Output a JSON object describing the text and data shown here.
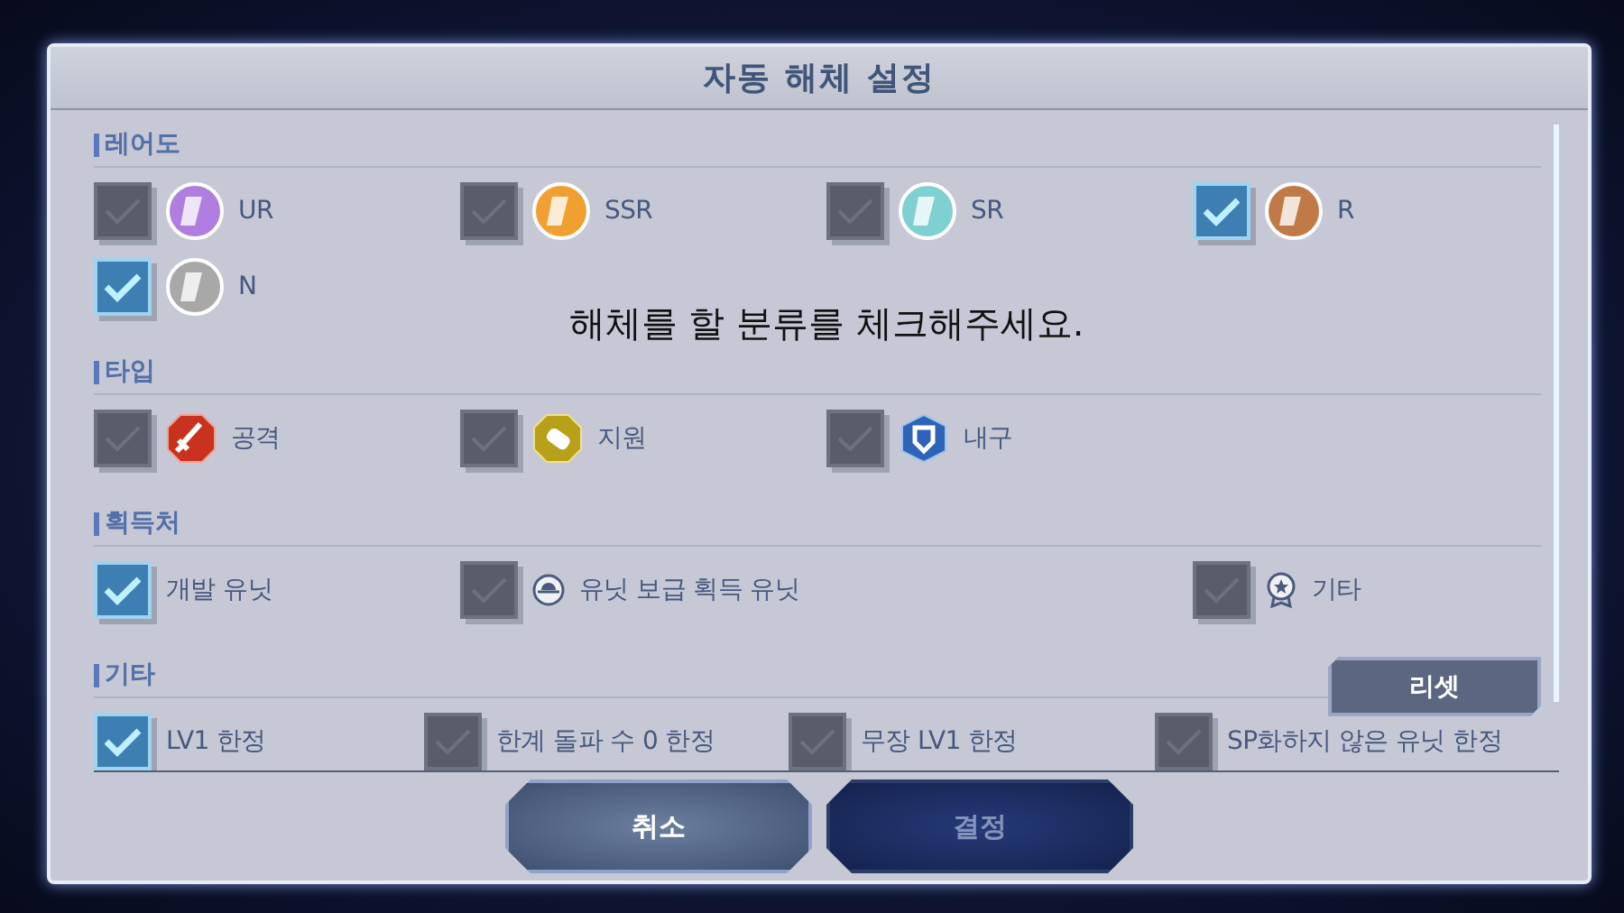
{
  "title": "자동 해체 설정",
  "sections": [
    {
      "heading": "레어도",
      "options": [
        {
          "label": "UR",
          "checked": false,
          "kind": "badge",
          "color": "#b07ee0"
        },
        {
          "label": "SSR",
          "checked": false,
          "kind": "badge",
          "color": "#f0a030"
        },
        {
          "label": "SR",
          "checked": false,
          "kind": "badge",
          "color": "#7fd0d0"
        },
        {
          "label": "R",
          "checked": true,
          "kind": "badge",
          "color": "#c07a48"
        },
        {
          "label": "N",
          "checked": true,
          "kind": "badge",
          "color": "#a8a8a8"
        }
      ]
    },
    {
      "heading": "타입",
      "options": [
        {
          "label": "공격",
          "checked": false,
          "kind": "attack"
        },
        {
          "label": "지원",
          "checked": false,
          "kind": "support"
        },
        {
          "label": "내구",
          "checked": false,
          "kind": "defense"
        }
      ]
    },
    {
      "heading": "획득처",
      "options": [
        {
          "label": "개발 유닛",
          "checked": true,
          "kind": "plain"
        },
        {
          "label": "유닛 보급 획득 유닛",
          "checked": false,
          "kind": "supply"
        },
        {
          "label": "기타",
          "checked": false,
          "kind": "medal"
        }
      ]
    },
    {
      "heading": "기타",
      "options": [
        {
          "label": "LV1 한정",
          "checked": true,
          "kind": "plain"
        },
        {
          "label": "한계 돌파 수 0 한정",
          "checked": false,
          "kind": "plain"
        },
        {
          "label": "무장 LV1 한정",
          "checked": false,
          "kind": "plain"
        },
        {
          "label": "SP화하지 않은 유닛 한정",
          "checked": false,
          "kind": "plain"
        }
      ]
    }
  ],
  "toast": "해체를 할 분류를 체크해주세요.",
  "reset_button": "리셋",
  "buttons": [
    {
      "label": "취소",
      "disabled": false
    },
    {
      "label": "결정",
      "disabled": true
    }
  ]
}
